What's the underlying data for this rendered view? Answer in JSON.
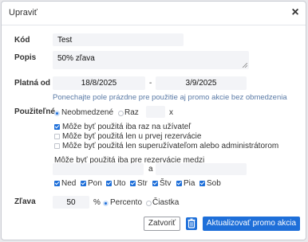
{
  "dialog": {
    "title": "Upraviť"
  },
  "form": {
    "code": {
      "label": "Kód",
      "value": "Test"
    },
    "description": {
      "label": "Popis",
      "value": "50% zľava"
    },
    "valid_from": {
      "label": "Platná od",
      "from": "18/8/2025",
      "separator": "-",
      "to": "3/9/2025",
      "hint": "Ponechajte pole prázdne pre použitie aj promo akcie bez obmedzenia"
    },
    "usable": {
      "label": "Použiteľné",
      "unlimited": "Neobmedzené",
      "once": "Raz",
      "times_value": "",
      "times_suffix": "x",
      "options": [
        {
          "label": "Môže byť použitá iba raz na užívateľ",
          "checked": true
        },
        {
          "label": "Môže byť použitá len u prvej rezervácie",
          "checked": false
        },
        {
          "label": "Môže byť použitá len superužívateľom alebo administrátorom",
          "checked": false
        }
      ],
      "between_label": "Môže byť použitá iba pre rezervácie medzi",
      "between_from": "",
      "between_and": "a",
      "between_to": ""
    },
    "days": [
      "Ned",
      "Pon",
      "Uto",
      "Str",
      "Štv",
      "Pia",
      "Sob"
    ],
    "discount": {
      "label": "Zľava",
      "value": "50",
      "unit": "%",
      "percent": "Percento",
      "amount": "Čiastka"
    }
  },
  "buttons": {
    "close": "Zatvoriť",
    "update": "Aktualizovať promo akcia"
  },
  "colors": {
    "accent": "#1e6fd9",
    "hint": "#5a7aa6",
    "field_bg": "#f3f4f7"
  },
  "icons": {
    "close": "close-icon",
    "delete": "trash-icon"
  }
}
